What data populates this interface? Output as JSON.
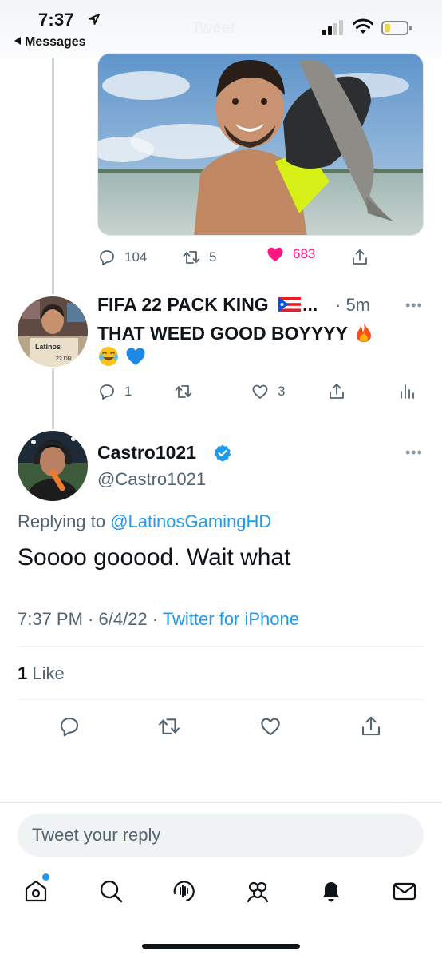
{
  "status_bar": {
    "time": "7:37",
    "back_label": "Messages",
    "ghost_title": "Tweet"
  },
  "tweet_actions": {
    "replies": "104",
    "retweets": "5",
    "likes": "683",
    "liked": true,
    "like_color": "#f91880"
  },
  "reply": {
    "name": "FIFA 22 PACK KING",
    "ellipsis": "...",
    "time": "· 5m",
    "text": "THAT WEED GOOD BOYYYY",
    "emojis": [
      "fire-emoji",
      "joy-emoji",
      "blue-heart-emoji"
    ],
    "avatar_caption": "Latinos",
    "avatar_subcaption": "22 DR",
    "replies": "1",
    "likes": "3"
  },
  "main_tweet": {
    "name": "Castro1021",
    "handle": "@Castro1021",
    "replying_prefix": "Replying to",
    "replying_to": "@LatinosGamingHD",
    "text": "Soooo gooood. Wait what",
    "timestamp": "7:37 PM · 6/4/22 ·",
    "source": "Twitter for iPhone",
    "like_count": "1",
    "like_label": "Like",
    "verified_color": "#1d9bf0"
  },
  "compose": {
    "placeholder": "Tweet your reply"
  },
  "tab_bar": {
    "items": [
      "home-icon",
      "search-icon",
      "spaces-icon",
      "communities-icon",
      "notifications-icon",
      "messages-icon"
    ],
    "active": "notifications-icon",
    "home_has_dot": true
  },
  "colors": {
    "accent": "#1d9bf0",
    "text_primary": "#0f1419",
    "text_secondary": "#536471"
  }
}
